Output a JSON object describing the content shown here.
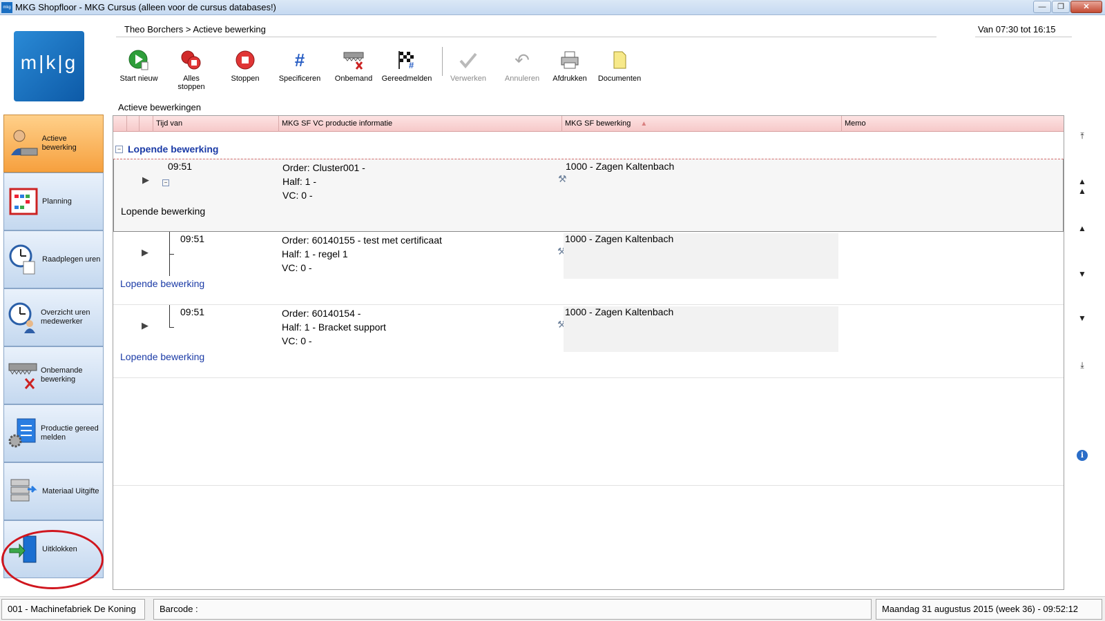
{
  "window": {
    "title": "MKG Shopfloor - MKG Cursus (alleen voor de cursus databases!)",
    "icon_text": "mkg"
  },
  "logo": {
    "text": "m|k|g"
  },
  "header": {
    "breadcrumb": "Theo Borchers > Actieve bewerking",
    "shift": "Van 07:30 tot 16:15"
  },
  "toolbar": {
    "start_nieuw": "Start nieuw",
    "alles_stoppen": "Alles stoppen",
    "stoppen": "Stoppen",
    "specificeren": "Specificeren",
    "onbemand": "Onbemand",
    "gereedmelden": "Gereedmelden",
    "verwerken": "Verwerken",
    "annuleren": "Annuleren",
    "afdrukken": "Afdrukken",
    "documenten": "Documenten"
  },
  "sidebar": {
    "items": [
      {
        "label": "Actieve bewerking",
        "icon": "worker-icon"
      },
      {
        "label": "Planning",
        "icon": "calendar-icon"
      },
      {
        "label": "Raadplegen uren",
        "icon": "clock-icon"
      },
      {
        "label": "Overzicht uren medewerker",
        "icon": "clock-worker-icon"
      },
      {
        "label": "Onbemande bewerking",
        "icon": "saw-icon"
      },
      {
        "label": "Productie gereed melden",
        "icon": "document-gear-icon"
      },
      {
        "label": "Materiaal Uitgifte",
        "icon": "boxes-icon"
      },
      {
        "label": "Uitklokken",
        "icon": "exit-door-icon"
      }
    ],
    "highlight_color": "#d0161e"
  },
  "grid": {
    "title": "Actieve bewerkingen",
    "columns": {
      "tijd_van": "Tijd van",
      "productie_info": "MKG SF VC productie informatie",
      "bewerking": "MKG SF bewerking",
      "memo": "Memo"
    },
    "group_label": "Lopende bewerking",
    "rows": [
      {
        "time": "09:51",
        "order": "Order: Cluster001 -",
        "half": "Half: 1 -",
        "vc": "VC: 0 -",
        "operation": "1000 - Zagen Kaltenbach",
        "status": "Lopende bewerking"
      },
      {
        "time": "09:51",
        "order": "Order: 60140155 - test met certificaat",
        "half": "Half: 1 - regel 1",
        "vc": "VC: 0 -",
        "operation": "1000 - Zagen Kaltenbach",
        "status": "Lopende bewerking"
      },
      {
        "time": "09:51",
        "order": "Order: 60140154 -",
        "half": "Half: 1 - Bracket support",
        "vc": "VC: 0 -",
        "operation": "1000 - Zagen Kaltenbach",
        "status": "Lopende bewerking"
      }
    ]
  },
  "statusbar": {
    "company": "001 - Machinefabriek De Koning",
    "barcode_label": "Barcode :",
    "datetime": "Maandag 31 augustus 2015 (week 36)  - 09:52:12"
  },
  "colors": {
    "accent_active": "#f6a03e",
    "header_pink": "#f6c9c9",
    "link_blue": "#1a3aa6"
  }
}
